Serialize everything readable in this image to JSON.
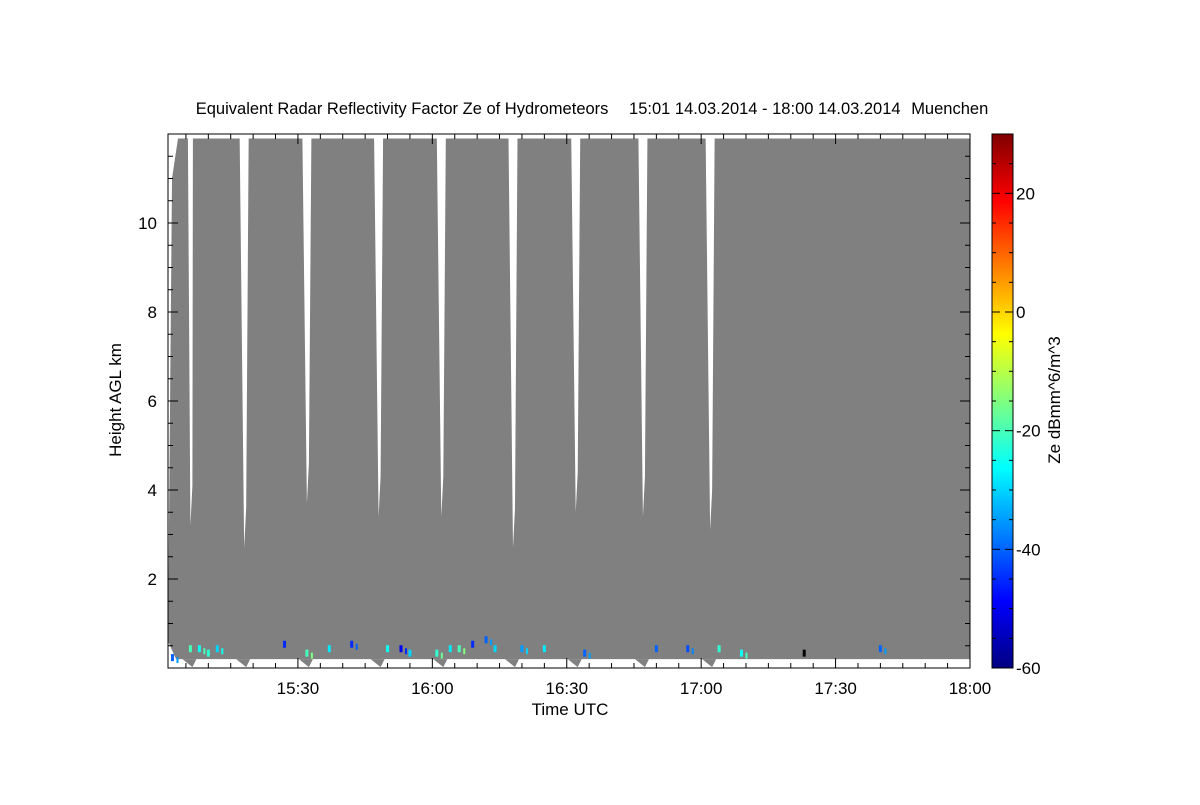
{
  "chart_data": {
    "type": "heatmap",
    "title": "Equivalent Radar Reflectivity Factor Ze of Hydrometeors",
    "period": "15:01 14.03.2014 - 18:00 14.03.2014",
    "location": "Muenchen",
    "xlabel": "Time UTC",
    "ylabel": "Height AGL km",
    "colorbar_label": "Ze dBmm^6/m^3",
    "xlim": [
      "15:01",
      "18:00"
    ],
    "ylim": [
      0,
      12
    ],
    "x_ticks": [
      "15:30",
      "16:00",
      "16:30",
      "17:00",
      "17:30",
      "18:00"
    ],
    "y_ticks": [
      "2",
      "4",
      "6",
      "8",
      "10"
    ],
    "colorbar_range": [
      -60,
      30
    ],
    "colorbar_ticks": [
      "-60",
      "-40",
      "-20",
      "0",
      "20"
    ],
    "colormap": "jet",
    "no_signal_color": "#808080",
    "gap_times": [
      "15:06",
      "15:18",
      "15:32",
      "15:48",
      "16:02",
      "16:18",
      "16:32",
      "16:47",
      "17:02"
    ],
    "echoes": [
      {
        "time": "15:02",
        "height_km": 0.2,
        "ze": -40
      },
      {
        "time": "15:06",
        "height_km": 0.4,
        "ze": -20
      },
      {
        "time": "15:08",
        "height_km": 0.4,
        "ze": -25
      },
      {
        "time": "15:10",
        "height_km": 0.3,
        "ze": -22
      },
      {
        "time": "15:12",
        "height_km": 0.4,
        "ze": -30
      },
      {
        "time": "15:27",
        "height_km": 0.5,
        "ze": -45
      },
      {
        "time": "15:32",
        "height_km": 0.3,
        "ze": -20
      },
      {
        "time": "15:37",
        "height_km": 0.4,
        "ze": -28
      },
      {
        "time": "15:42",
        "height_km": 0.5,
        "ze": -45
      },
      {
        "time": "15:50",
        "height_km": 0.4,
        "ze": -25
      },
      {
        "time": "15:53",
        "height_km": 0.4,
        "ze": -50
      },
      {
        "time": "15:55",
        "height_km": 0.3,
        "ze": -30
      },
      {
        "time": "16:01",
        "height_km": 0.3,
        "ze": -22
      },
      {
        "time": "16:04",
        "height_km": 0.4,
        "ze": -28
      },
      {
        "time": "16:06",
        "height_km": 0.4,
        "ze": -20
      },
      {
        "time": "16:09",
        "height_km": 0.5,
        "ze": -45
      },
      {
        "time": "16:12",
        "height_km": 0.6,
        "ze": -40
      },
      {
        "time": "16:14",
        "height_km": 0.4,
        "ze": -30
      },
      {
        "time": "16:20",
        "height_km": 0.4,
        "ze": -35
      },
      {
        "time": "16:25",
        "height_km": 0.4,
        "ze": -28
      },
      {
        "time": "16:34",
        "height_km": 0.3,
        "ze": -40
      },
      {
        "time": "16:50",
        "height_km": 0.4,
        "ze": -40
      },
      {
        "time": "16:57",
        "height_km": 0.4,
        "ze": -42
      },
      {
        "time": "17:04",
        "height_km": 0.4,
        "ze": -22
      },
      {
        "time": "17:09",
        "height_km": 0.3,
        "ze": -25
      },
      {
        "time": "17:23",
        "height_km": 0.3,
        "ze": -60
      },
      {
        "time": "17:40",
        "height_km": 0.4,
        "ze": -40
      }
    ]
  }
}
